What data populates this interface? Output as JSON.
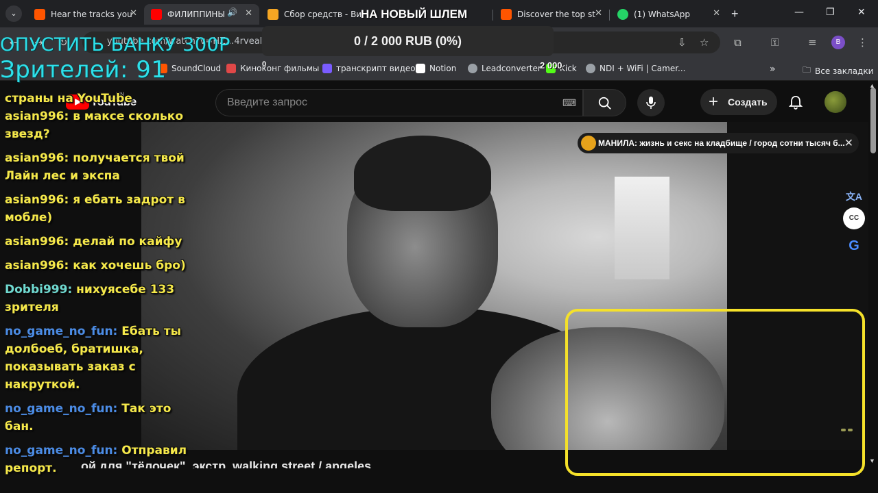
{
  "browser": {
    "tabs": [
      {
        "title": "Hear the tracks you",
        "favicon_color": "#ff5500"
      },
      {
        "title": "ФИЛИППИНЫ",
        "favicon_color": "#ff0000",
        "active": true
      },
      {
        "title": "Сбор средств - Ви",
        "favicon_color": "#f5a623"
      },
      {
        "title": "Discover the top st",
        "favicon_color": "#ff5500"
      },
      {
        "title": "(1) WhatsApp",
        "favicon_color": "#25d366"
      }
    ],
    "url": "youtube.com/watch?v=HZ...4rveal",
    "profile_initial": "B",
    "bookmarks": [
      {
        "label": "SoundCloud",
        "color": "#ff5500"
      },
      {
        "label": "Киноконг фильмы",
        "color": "#e04848"
      },
      {
        "label": "транскрипт видео",
        "color": "#7a5cff"
      },
      {
        "label": "Notion",
        "color": "#ffffff"
      },
      {
        "label": "Leadconverter",
        "color": "#9aa0a6"
      },
      {
        "label": "Kick",
        "color": "#53fc18"
      },
      {
        "label": "NDI + WiFi | Camer...",
        "color": "#9aa0a6"
      }
    ],
    "all_bookmarks": "Все закладки"
  },
  "youtube": {
    "logo_text": "YouTube",
    "region": "VN",
    "search_placeholder": "Введите запрос",
    "create_label": "Создать",
    "notification_text": "МАНИЛА: жизнь и секс на кладбище / город сотни тысяч б...",
    "video_title_partial": "…ой для \"тёлочек\", экстр. walking street / angeles"
  },
  "overlay": {
    "title_line1": "ОПУСТИТЬ БАНКУ 300Р",
    "title_line2": "Зрителей: 91",
    "goal_title": "НА НОВЫЙ ШЛЕМ",
    "goal_text": "0 / 2 000 RUB (0%)",
    "goal_progress": 0,
    "counter_left": "0",
    "counter_right": "2 000",
    "goal_bar_color": "#2b2b2b",
    "chat_accent": "#f6e94a"
  },
  "chat": {
    "header_partial": "страны на YouTube",
    "messages": [
      {
        "user": "asian996",
        "text": "в максе сколько звезд?",
        "user_color": "#f6e94a"
      },
      {
        "user": "asian996",
        "text": "получается твой Лайн лес и экспа",
        "user_color": "#f6e94a"
      },
      {
        "user": "asian996",
        "text": "я ебать задрот в мобле)",
        "user_color": "#f6e94a"
      },
      {
        "user": "asian996",
        "text": "делай по кайфу",
        "user_color": "#f6e94a"
      },
      {
        "user": "asian996",
        "text": "как хочешь бро)",
        "user_color": "#f6e94a"
      },
      {
        "user": "Dobbi999",
        "text": "нихуясебе 133 зрителя",
        "user_color": "#6fd9d0"
      },
      {
        "user": "no_game_no_fun",
        "text": "Ебать ты долбоеб, братишка, показывать заказ с накруткой.",
        "user_color": "#4b8ce6"
      },
      {
        "user": "no_game_no_fun",
        "text": "Так это бан.",
        "user_color": "#4b8ce6"
      },
      {
        "user": "no_game_no_fun",
        "text": "Отправил репорт.",
        "user_color": "#4b8ce6"
      }
    ]
  }
}
